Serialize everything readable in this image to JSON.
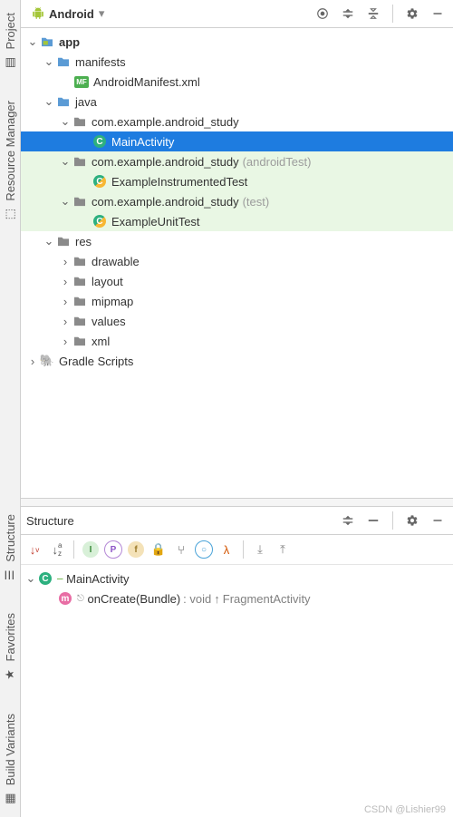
{
  "gutter": {
    "project": "Project",
    "resource_manager": "Resource Manager",
    "structure": "Structure",
    "favorites": "Favorites",
    "build_variants": "Build Variants"
  },
  "project_panel": {
    "view_mode": "Android",
    "tree": {
      "app": {
        "label": "app"
      },
      "manifests": {
        "label": "manifests"
      },
      "android_manifest": {
        "label": "AndroidManifest.xml"
      },
      "java": {
        "label": "java"
      },
      "pkg_main": {
        "label": "com.example.android_study"
      },
      "main_activity": {
        "label": "MainActivity"
      },
      "pkg_android_test": {
        "label": "com.example.android_study",
        "suffix": "(androidTest)"
      },
      "example_instr": {
        "label": "ExampleInstrumentedTest"
      },
      "pkg_test": {
        "label": "com.example.android_study",
        "suffix": "(test)"
      },
      "example_unit": {
        "label": "ExampleUnitTest"
      },
      "res": {
        "label": "res"
      },
      "drawable": {
        "label": "drawable"
      },
      "layout": {
        "label": "layout"
      },
      "mipmap": {
        "label": "mipmap"
      },
      "values": {
        "label": "values"
      },
      "xml": {
        "label": "xml"
      },
      "gradle": {
        "label": "Gradle Scripts"
      }
    }
  },
  "structure_panel": {
    "title": "Structure",
    "class": {
      "name": "MainActivity"
    },
    "method": {
      "name": "onCreate(Bundle)",
      "return": ": void",
      "inherited": "FragmentActivity"
    }
  },
  "watermark": "CSDN @Lishier99"
}
